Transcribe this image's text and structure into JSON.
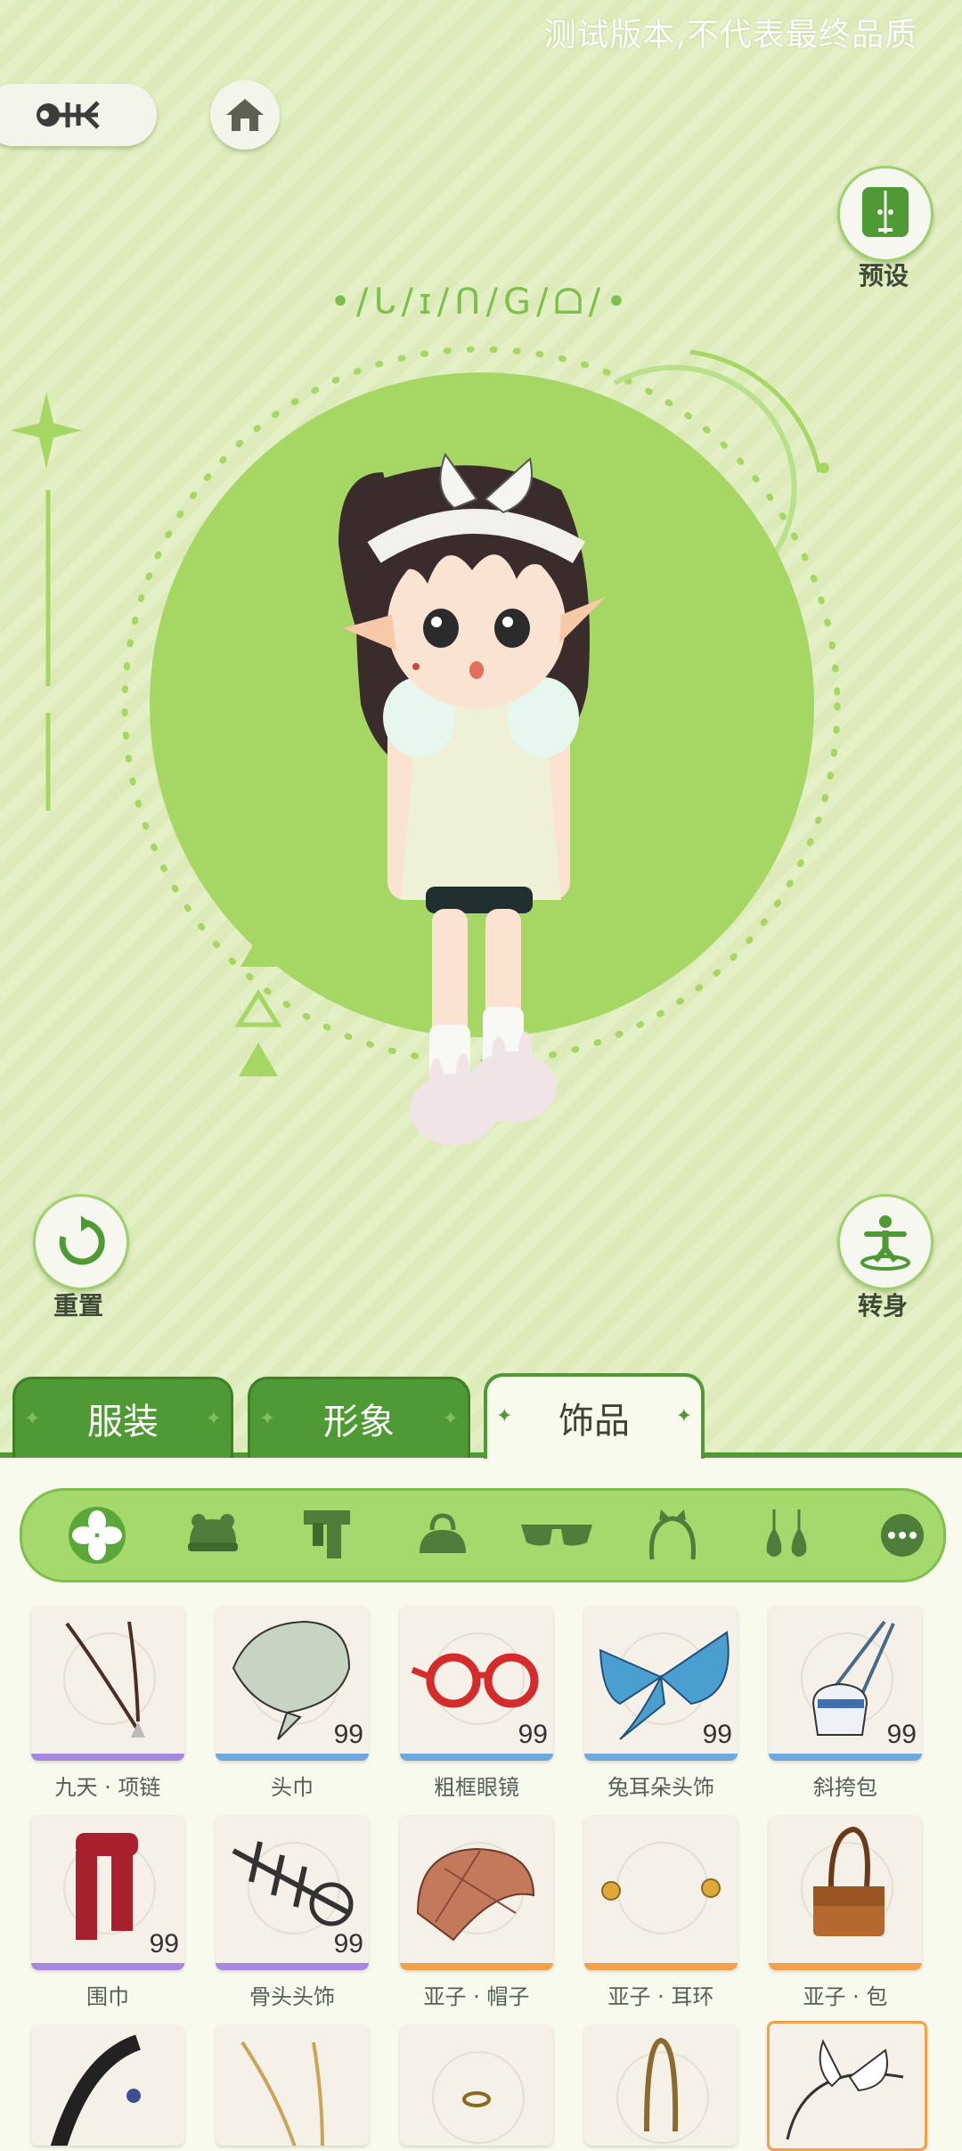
{
  "watermark": "测试版本,不代表最终品质",
  "header": {
    "logo_text": "≪",
    "home_icon": "home-icon"
  },
  "stage": {
    "title_glyphs": "•/ᒐ/ɪ/ᑎ/G/ᗝ/•"
  },
  "actions": {
    "preset_label": "预设",
    "reset_label": "重置",
    "turn_label": "转身"
  },
  "tabs": [
    {
      "label": "服装",
      "active": false
    },
    {
      "label": "形象",
      "active": false
    },
    {
      "label": "饰品",
      "active": true
    }
  ],
  "categories": [
    "flower-icon",
    "frog-hat-icon",
    "scarf-icon",
    "bag-icon",
    "sunglasses-icon",
    "headband-icon",
    "earrings-icon",
    "more-icon"
  ],
  "colors": {
    "accent": "#4f9a35",
    "purple": "#a788e0",
    "blue": "#6fa8dc",
    "orange": "#f2a14a"
  },
  "items": [
    {
      "name": "九天 · 项链",
      "count": "",
      "rarity": "purple"
    },
    {
      "name": "头巾",
      "count": "99",
      "rarity": "blue"
    },
    {
      "name": "粗框眼镜",
      "count": "99",
      "rarity": "blue"
    },
    {
      "name": "兔耳朵头饰",
      "count": "99",
      "rarity": "blue"
    },
    {
      "name": "斜挎包",
      "count": "99",
      "rarity": "blue"
    },
    {
      "name": "围巾",
      "count": "99",
      "rarity": "purple"
    },
    {
      "name": "骨头头饰",
      "count": "99",
      "rarity": "purple"
    },
    {
      "name": "亚子 · 帽子",
      "count": "",
      "rarity": "orange"
    },
    {
      "name": "亚子 · 耳环",
      "count": "",
      "rarity": "orange"
    },
    {
      "name": "亚子 · 包",
      "count": "",
      "rarity": "orange"
    }
  ]
}
